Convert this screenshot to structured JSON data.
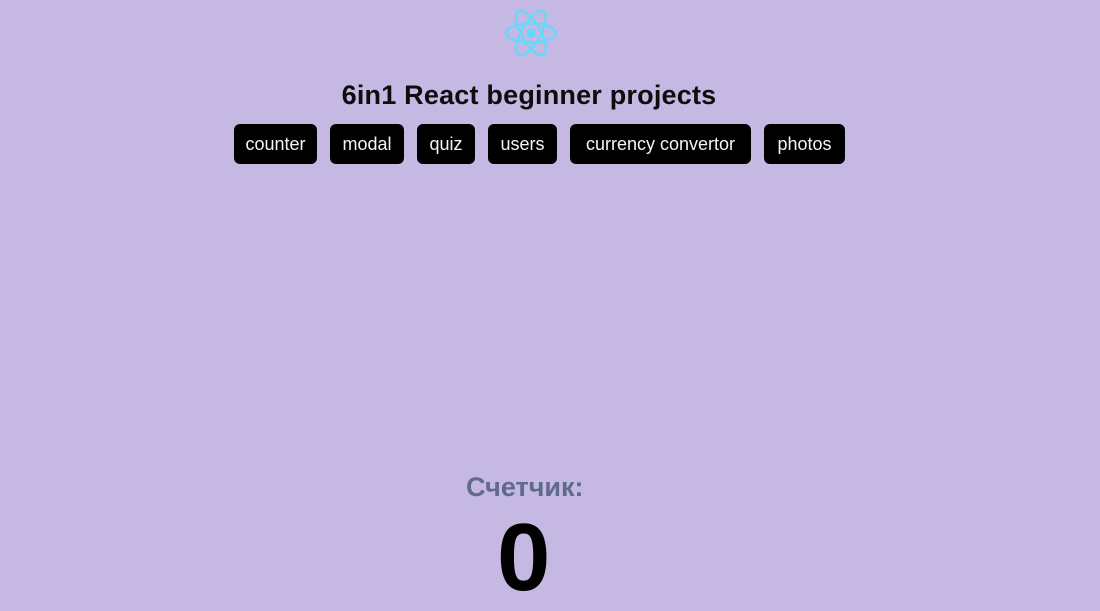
{
  "header": {
    "logo_icon": "react-atom-icon",
    "logo_color": "#61dafb",
    "title": "6in1 React beginner projects"
  },
  "nav": {
    "items": [
      {
        "label": "counter"
      },
      {
        "label": "modal"
      },
      {
        "label": "quiz"
      },
      {
        "label": "users"
      },
      {
        "label": "currency convertor"
      },
      {
        "label": "photos"
      }
    ]
  },
  "counter": {
    "heading": "Счетчик:",
    "value": "0"
  },
  "theme": {
    "background": "#c5b8e2",
    "button_bg": "#000000",
    "button_text": "#f5f5f5",
    "heading_color": "#5f6a8c"
  }
}
